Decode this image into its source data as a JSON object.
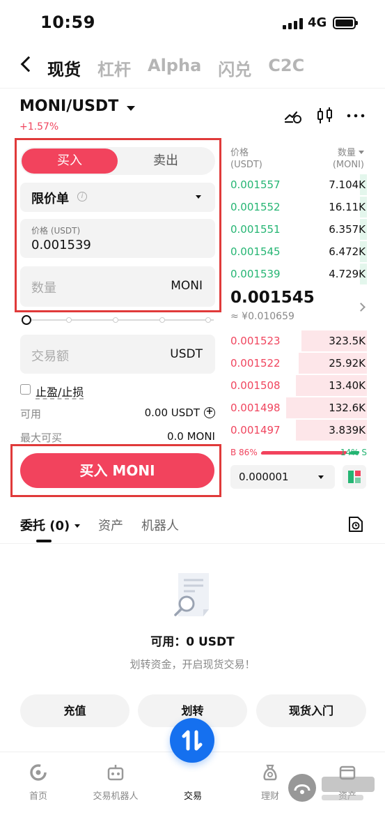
{
  "status_bar": {
    "time": "10:59",
    "network": "4G"
  },
  "nav": {
    "tabs": [
      {
        "label": "现货",
        "active": true
      },
      {
        "label": "杠杆",
        "active": false
      },
      {
        "label": "Alpha",
        "active": false
      },
      {
        "label": "闪兑",
        "active": false
      },
      {
        "label": "C2C",
        "active": false
      }
    ]
  },
  "pair": {
    "symbol": "MONI/USDT",
    "change": "+1.57%"
  },
  "order_form": {
    "side_buy": "买入",
    "side_sell": "卖出",
    "order_type": "限价单",
    "price_label": "价格 (USDT)",
    "price_value": "0.001539",
    "qty_placeholder": "数量",
    "qty_unit": "MONI",
    "amount_placeholder": "交易额",
    "amount_unit": "USDT",
    "tp_sl_label": "止盈/止损",
    "available_label": "可用",
    "available_value": "0.00 USDT",
    "max_buy_label": "最大可买",
    "max_buy_value": "0.0 MONI",
    "submit_label": "买入 MONI"
  },
  "order_book": {
    "price_header": "价格",
    "price_unit": "(USDT)",
    "qty_header": "数量",
    "qty_unit": "(MONI)",
    "asks": [
      {
        "price": "0.001557",
        "qty": "7.104K",
        "depth": 0.05
      },
      {
        "price": "0.001552",
        "qty": "16.11K",
        "depth": 0.05
      },
      {
        "price": "0.001551",
        "qty": "6.357K",
        "depth": 0.05
      },
      {
        "price": "0.001545",
        "qty": "6.472K",
        "depth": 0.05
      },
      {
        "price": "0.001539",
        "qty": "4.729K",
        "depth": 0.05
      }
    ],
    "last_price": "0.001545",
    "last_price_fiat": "≈ ¥0.010659",
    "bids": [
      {
        "price": "0.001523",
        "qty": "323.5K",
        "depth": 0.48
      },
      {
        "price": "0.001522",
        "qty": "25.92K",
        "depth": 0.5
      },
      {
        "price": "0.001508",
        "qty": "13.40K",
        "depth": 0.52
      },
      {
        "price": "0.001498",
        "qty": "132.6K",
        "depth": 0.59
      },
      {
        "price": "0.001497",
        "qty": "3.839K",
        "depth": 0.52
      }
    ],
    "buy_ratio": "B 86%",
    "sell_ratio": "14% S",
    "precision": "0.000001"
  },
  "orders_section": {
    "tab_orders": "委托 (0)",
    "tab_assets": "资产",
    "tab_bots": "机器人",
    "available_text": "可用：0 USDT",
    "hint": "划转资金，开启现货交易！",
    "btn_deposit": "充值",
    "btn_transfer": "划转",
    "btn_guide": "现货入门"
  },
  "bottom_nav": {
    "home": "首页",
    "bots": "交易机器人",
    "trade": "交易",
    "finance": "理财",
    "assets": "资产"
  },
  "colors": {
    "buy": "#f2435d",
    "sell": "#25b573",
    "brand": "#1570ef",
    "highlight_box": "#e03a3a"
  }
}
